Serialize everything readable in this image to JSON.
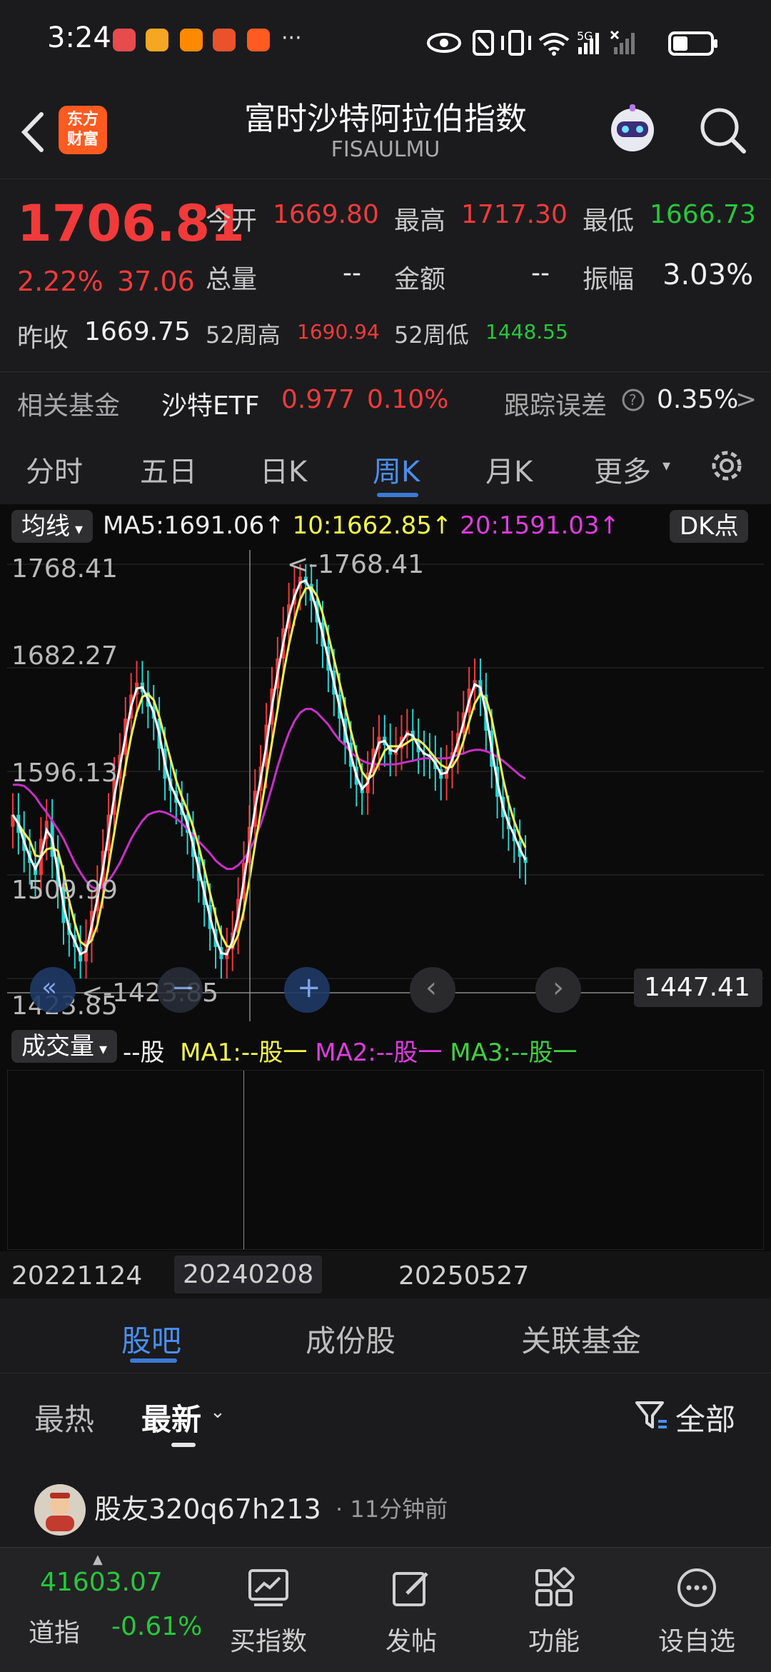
{
  "status": {
    "time": "3:24",
    "more": "···"
  },
  "header": {
    "logo_line1": "东方",
    "logo_line2": "财富",
    "title": "富时沙特阿拉伯指数",
    "subtitle": "FISAULMU"
  },
  "quote": {
    "price": "1706.81",
    "change_pct": "2.22%",
    "change": "37.06",
    "open_label": "今开",
    "open": "1669.80",
    "high_label": "最高",
    "high": "1717.30",
    "low_label": "最低",
    "low": "1666.73",
    "volume_label": "总量",
    "volume": "--",
    "amount_label": "金额",
    "amount": "--",
    "amplitude_label": "振幅",
    "amplitude": "3.03%",
    "prev_close_label": "昨收",
    "prev_close": "1669.75",
    "wk52_high_label": "52周高",
    "wk52_high": "1690.94",
    "wk52_low_label": "52周低",
    "wk52_low": "1448.55",
    "fund_label": "相关基金",
    "fund_name": "沙特ETF",
    "fund_price": "0.977",
    "fund_pct": "0.10%",
    "tracking_label": "跟踪误差",
    "tracking_value": "0.35%",
    "tracking_arrow": ">"
  },
  "ktabs": [
    {
      "label": "分时"
    },
    {
      "label": "五日"
    },
    {
      "label": "日K"
    },
    {
      "label": "周K"
    },
    {
      "label": "月K"
    },
    {
      "label": "更多"
    }
  ],
  "chart": {
    "ma_selector": "均线",
    "ma5": "MA5:1691.06↑",
    "ma10": "10:1662.85↑",
    "ma20": "20:1591.03↑",
    "dk_button": "DK点",
    "axis_labels": [
      "1768.41",
      "1682.27",
      "1596.13",
      "1509.99",
      "1423.85"
    ],
    "max_marker": "<-1768.41",
    "min_marker": "<-1423.85",
    "crosshair_value": "1447.41",
    "vol_selector": "成交量",
    "vol_value": "--股",
    "vol_ma1": "MA1:--股一",
    "vol_ma2": "MA2:--股一",
    "vol_ma3": "MA3:--股一",
    "dates": [
      "20221124",
      "20240208",
      "20250527"
    ],
    "colors": {
      "up": "#f23a3a",
      "down": "#27d3d3",
      "ma5": "#ffffff",
      "ma10": "#f6f64a",
      "ma20": "#c82fc8"
    }
  },
  "chart_data": {
    "type": "candlestick",
    "ylim": [
      1423.85,
      1768.41
    ],
    "y_ticks": [
      1768.41,
      1682.27,
      1596.13,
      1509.99,
      1423.85
    ],
    "x_ticks": [
      "20221124",
      "20240208",
      "20250527"
    ],
    "close": [
      1560,
      1545,
      1530,
      1520,
      1510,
      1540,
      1555,
      1525,
      1500,
      1470,
      1460,
      1450,
      1438,
      1455,
      1480,
      1500,
      1530,
      1560,
      1590,
      1610,
      1640,
      1660,
      1670,
      1662,
      1650,
      1640,
      1615,
      1590,
      1580,
      1570,
      1560,
      1545,
      1525,
      1505,
      1485,
      1465,
      1450,
      1440,
      1448,
      1462,
      1490,
      1520,
      1550,
      1580,
      1600,
      1635,
      1665,
      1690,
      1715,
      1735,
      1748,
      1758,
      1752,
      1738,
      1720,
      1700,
      1680,
      1660,
      1640,
      1620,
      1600,
      1585,
      1578,
      1595,
      1615,
      1625,
      1618,
      1610,
      1615,
      1625,
      1630,
      1622,
      1612,
      1610,
      1608,
      1598,
      1590,
      1600,
      1612,
      1628,
      1645,
      1665,
      1672,
      1660,
      1630,
      1600,
      1575,
      1558,
      1548,
      1538,
      1525,
      1520
    ],
    "ma20": [
      1585,
      1585,
      1584,
      1580,
      1575,
      1568,
      1562,
      1555,
      1548,
      1540,
      1530,
      1520,
      1512,
      1505,
      1500,
      1498,
      1500,
      1505,
      1512,
      1520,
      1530,
      1540,
      1548,
      1555,
      1560,
      1562,
      1563,
      1562,
      1560,
      1557,
      1553,
      1548,
      1543,
      1538,
      1533,
      1528,
      1522,
      1518,
      1515,
      1515,
      1518,
      1523,
      1530,
      1540,
      1552,
      1567,
      1583,
      1600,
      1615,
      1628,
      1638,
      1645,
      1648,
      1648,
      1645,
      1640,
      1635,
      1628,
      1622,
      1618,
      1612,
      1608,
      1605,
      1603,
      1602,
      1602,
      1602,
      1602,
      1602,
      1603,
      1604,
      1605,
      1606,
      1607,
      1607,
      1607,
      1607,
      1607,
      1608,
      1610,
      1611,
      1613,
      1614,
      1614,
      1613,
      1611,
      1608,
      1605,
      1601,
      1597,
      1593,
      1590
    ]
  },
  "sections": [
    {
      "label": "股吧"
    },
    {
      "label": "成份股"
    },
    {
      "label": "关联基金"
    }
  ],
  "filter": {
    "hot": "最热",
    "latest": "最新",
    "all": "全部"
  },
  "post": {
    "user": "股友320q67h213",
    "time": "· 11分钟前"
  },
  "bottom": {
    "index_value": "41603.07",
    "index_name": "道指",
    "index_pct": "-0.61%",
    "items": [
      {
        "label": "买指数"
      },
      {
        "label": "发帖"
      },
      {
        "label": "功能"
      },
      {
        "label": "设自选"
      }
    ]
  }
}
